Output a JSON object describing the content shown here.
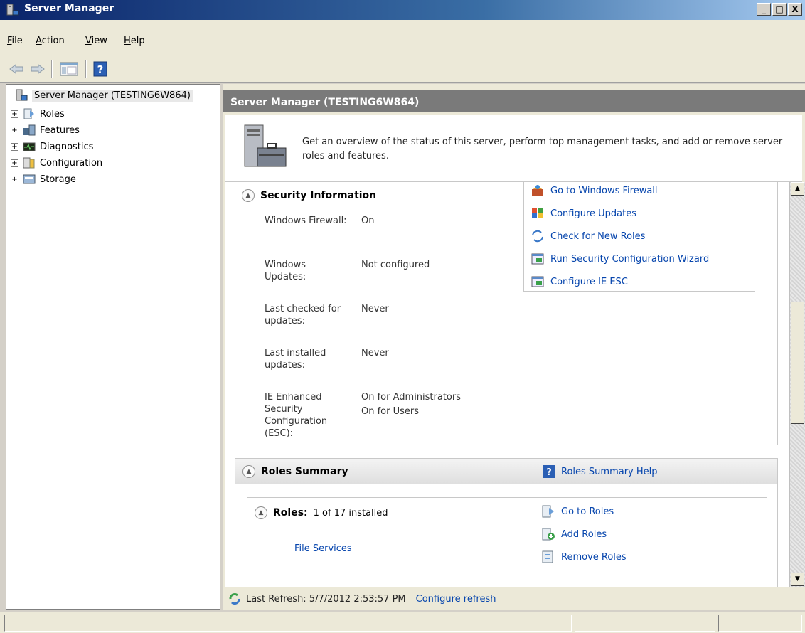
{
  "window": {
    "title": "Server Manager",
    "buttons": [
      "_",
      "□",
      "X"
    ]
  },
  "menu": {
    "items": [
      {
        "label": "File",
        "key": "F",
        "rest": "ile"
      },
      {
        "label": "Action",
        "key": "A",
        "rest": "ction"
      },
      {
        "label": "View",
        "key": "V",
        "rest": "iew"
      },
      {
        "label": "Help",
        "key": "H",
        "rest": "elp"
      }
    ]
  },
  "toolbar": {
    "icons": [
      "back-arrow-icon",
      "forward-arrow-icon",
      "show-hide-console-tree-icon",
      "help-icon"
    ],
    "help_glyph": "?"
  },
  "tree": {
    "root": "Server Manager (TESTING6W864)",
    "items": [
      "Roles",
      "Features",
      "Diagnostics",
      "Configuration",
      "Storage"
    ],
    "expander": "+"
  },
  "main": {
    "header": "Server Manager (TESTING6W864)",
    "overview": "Get an overview of the status of this server, perform top management tasks, and add or remove server roles and features."
  },
  "security": {
    "title": "Security Information",
    "rows": [
      {
        "label": "Windows Firewall:",
        "value": "On"
      },
      {
        "label": "Windows Updates:",
        "value": "Not configured"
      },
      {
        "label": "Last checked for updates:",
        "value": "Never"
      },
      {
        "label": "Last installed updates:",
        "value": "Never"
      },
      {
        "label": "IE Enhanced Security Configuration (ESC):",
        "value": "On for Administrators",
        "value2": "On for Users"
      }
    ],
    "actions": [
      "Go to Windows Firewall",
      "Configure Updates",
      "Check for New Roles",
      "Run Security Configuration Wizard",
      "Configure IE ESC"
    ]
  },
  "roles_summary": {
    "title": "Roles Summary",
    "help_label": "Roles Summary Help",
    "roles_label": "Roles:",
    "roles_count": "1 of 17 installed",
    "installed": [
      "File Services"
    ],
    "actions": [
      "Go to Roles",
      "Add Roles",
      "Remove Roles"
    ]
  },
  "refresh": {
    "text": "Last Refresh: 5/7/2012 2:53:57 PM",
    "link": "Configure refresh"
  },
  "colors": {
    "link": "#0645ad",
    "header_bg": "#7a7a7a",
    "title_bar": "#0a246a"
  }
}
